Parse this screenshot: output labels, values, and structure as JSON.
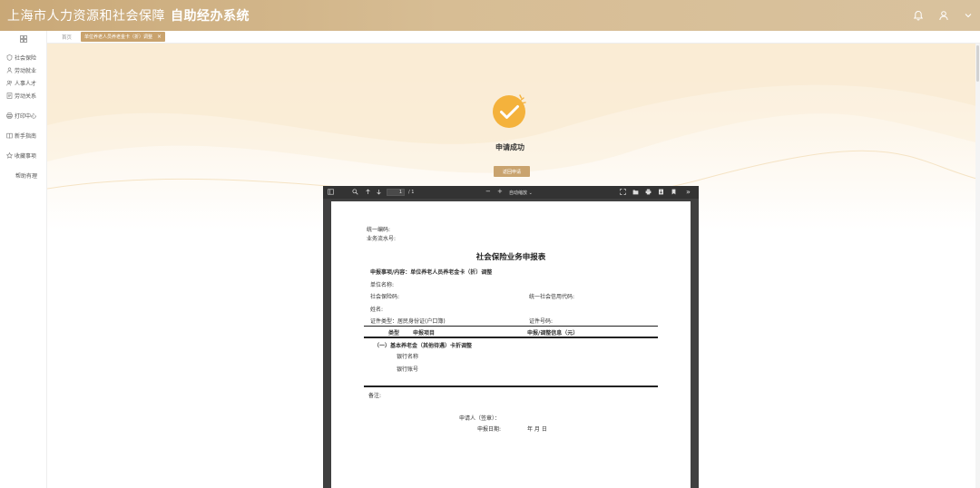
{
  "header": {
    "title_main": "上海市人力资源和社会保障",
    "title_strong": "自助经办系统",
    "icons": [
      "bell-icon",
      "user-icon",
      "chevron-down-icon"
    ]
  },
  "sidebar": {
    "items": [
      {
        "label": "社会保险",
        "icon": "shield-icon"
      },
      {
        "label": "劳动就业",
        "icon": "person-icon"
      },
      {
        "label": "人事人才",
        "icon": "people-icon"
      },
      {
        "label": "劳动关系",
        "icon": "document-icon"
      },
      {
        "label": "打印中心",
        "icon": "printer-icon"
      },
      {
        "label": "新手指南",
        "icon": "book-icon"
      },
      {
        "label": "收藏事项",
        "icon": "star-icon"
      },
      {
        "label": "帮助有理",
        "icon": ""
      }
    ]
  },
  "tabs": {
    "home": "首页",
    "active": "单位养老人员养老金卡（折）调整",
    "close": "×"
  },
  "result": {
    "message": "申请成功",
    "return_button": "返回申请"
  },
  "pdf_toolbar": {
    "page_current": "1",
    "page_total": "/ 1",
    "zoom_out": "−",
    "zoom_in": "+",
    "zoom_level": "自动缩放",
    "zoom_caret": "⌄",
    "more": "»"
  },
  "document": {
    "unified_code_label": "统一编码:",
    "serial_label": "业务流水号:",
    "title": "社会保险业务申报表",
    "matter": "申报事项/内容：单位养老人员养老金卡（折）调整",
    "unit_name": "单位名称:",
    "social_code": "社会保险码:",
    "credit_code": "统一社会信用代码:",
    "name": "姓名:",
    "id_type": "证件类型：居民身份证(户口簿)",
    "id_number": "证件号码:",
    "col_type": "类型",
    "col_item": "申报项目",
    "col_info": "申报/调整信息（元）",
    "section": "（一）基本养老金（其他待遇）卡折调整",
    "bank_name": "银行名称",
    "bank_account": "银行账号",
    "remarks": "备注:",
    "applicant": "申请人（签章）：",
    "date_label": "申报日期:",
    "date_value": "年    月    日"
  },
  "colors": {
    "header_gold": "#c9a877",
    "accent_gold": "#c9a36e",
    "success_orange": "#f4b23c"
  }
}
